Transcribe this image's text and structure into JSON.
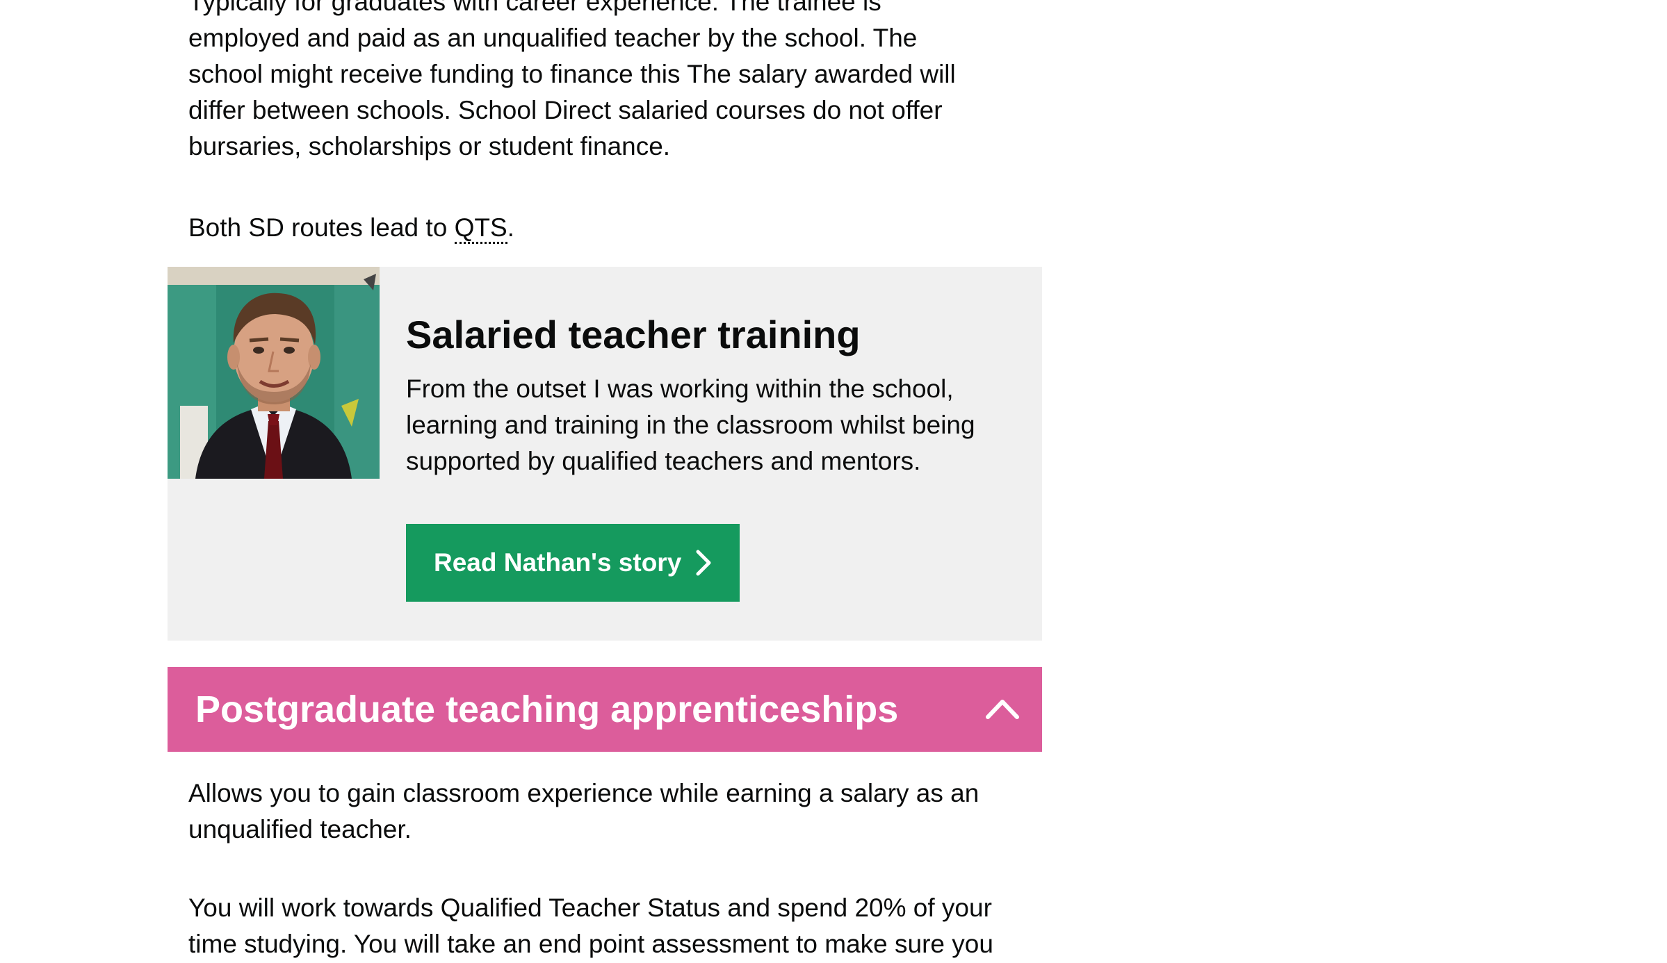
{
  "sd_salaried": {
    "paragraph_lines": [
      "Typically for graduates with career experience. The trainee is",
      "employed and paid as an unqualified teacher by the school. The",
      "school might receive funding to finance this The salary awarded will",
      "differ between schools. School Direct salaried courses do not offer",
      "bursaries, scholarships or student finance."
    ],
    "routes_prefix": "Both SD routes lead to ",
    "routes_abbr": "QTS",
    "routes_suffix": "."
  },
  "story_card": {
    "photo_alt": "Nathan",
    "heading": "Salaried teacher training",
    "quote_lines": [
      "From the outset I was working within the school,",
      "learning and training in the classroom whilst being",
      "supported by qualified teachers and mentors."
    ],
    "button_label": "Read Nathan's story",
    "button_icon": "chevron-right-icon",
    "button_color": "#159a5e"
  },
  "apprenticeships": {
    "accordion_title": "Postgraduate teaching apprenticeships",
    "toggle_icon": "chevron-up-icon",
    "header_color": "#dc5d9b",
    "paragraph_1_lines": [
      "Allows you to gain classroom experience while earning a salary as an",
      "unqualified teacher."
    ],
    "paragraph_2_lines": [
      "You will work towards Qualified Teacher Status and spend 20% of your",
      "time studying. You will take an end point assessment to make sure you"
    ]
  }
}
